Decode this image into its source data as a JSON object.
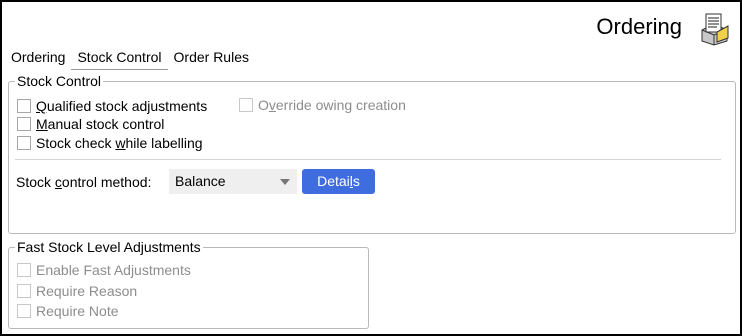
{
  "window": {
    "title": "Ordering",
    "icon": "notebook-icon"
  },
  "tabs": [
    {
      "label": "Ordering",
      "active": false
    },
    {
      "label": "Stock Control",
      "active": true
    },
    {
      "label": "Order Rules",
      "active": false
    }
  ],
  "stock_control": {
    "title": "Stock Control",
    "options": {
      "qualified": {
        "pre": "",
        "mn": "Q",
        "post": "ualified stock adjustments",
        "checked": false,
        "enabled": true
      },
      "override": {
        "pre": "O",
        "mn": "v",
        "post": "erride owing creation",
        "checked": false,
        "enabled": false
      },
      "manual": {
        "pre": "",
        "mn": "M",
        "post": "anual stock control",
        "checked": false,
        "enabled": true
      },
      "stock_check": {
        "pre": "Stock check ",
        "mn": "w",
        "post": "hile labelling",
        "checked": false,
        "enabled": true
      }
    },
    "method": {
      "label_pre": "Stock ",
      "label_mn": "c",
      "label_post": "ontrol method:",
      "value": "Balance",
      "details_pre": "Detai",
      "details_mn": "l",
      "details_post": "s"
    }
  },
  "fast_stock": {
    "title": "Fast Stock Level Adjustments",
    "options": [
      {
        "label": "Enable Fast Adjustments",
        "checked": false,
        "enabled": false
      },
      {
        "label": "Require Reason",
        "checked": false,
        "enabled": false
      },
      {
        "label": "Require Note",
        "checked": false,
        "enabled": false
      }
    ]
  },
  "colors": {
    "accent": "#3f6de0",
    "disabled_text": "#8d8d8d",
    "border": "#b9b9b9"
  }
}
